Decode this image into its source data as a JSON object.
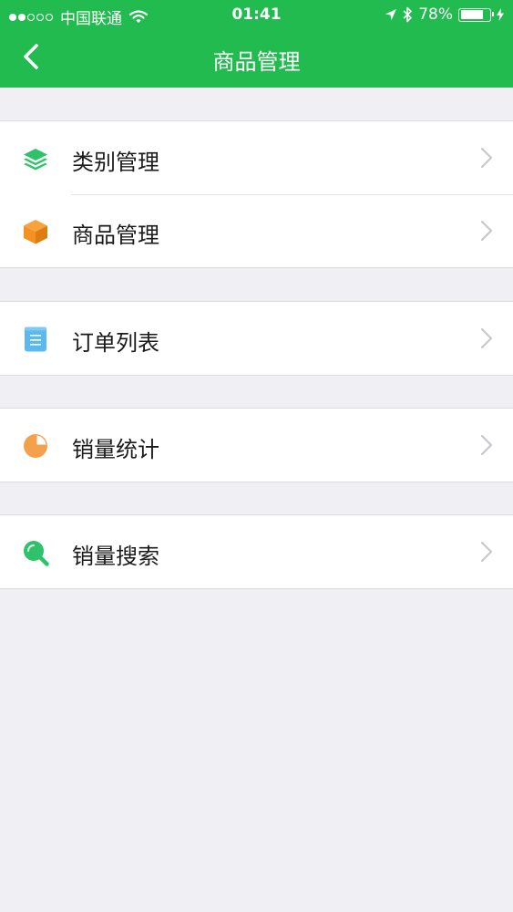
{
  "status_bar": {
    "carrier": "中国联通",
    "time": "01:41",
    "battery": "78%",
    "battery_level": 0.78,
    "signal_bars_filled": 2,
    "signal_bars_total": 5
  },
  "nav": {
    "title": "商品管理"
  },
  "theme": {
    "accent": "#22bb4f",
    "background": "#efeff4"
  },
  "groups": [
    {
      "items": [
        {
          "label": "类别管理",
          "icon": "layers-icon",
          "icon_color": "#2ec26a"
        },
        {
          "label": "商品管理",
          "icon": "box-icon",
          "icon_color": "#f39222"
        }
      ]
    },
    {
      "items": [
        {
          "label": "订单列表",
          "icon": "document-icon",
          "icon_color": "#5ab9ef"
        }
      ]
    },
    {
      "items": [
        {
          "label": "销量统计",
          "icon": "pie-chart-icon",
          "icon_color": "#f5a04c"
        }
      ]
    },
    {
      "items": [
        {
          "label": "销量搜索",
          "icon": "search-icon",
          "icon_color": "#2ec26a"
        }
      ]
    }
  ]
}
